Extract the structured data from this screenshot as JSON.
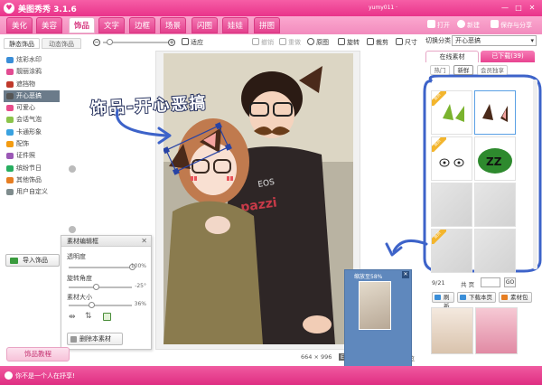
{
  "window": {
    "title": "美图秀秀 3.1.6",
    "user": "yumy011 ·",
    "controls": [
      "—",
      "□",
      "✕"
    ]
  },
  "nav": {
    "tabs": [
      "美化",
      "美容",
      "饰品",
      "文字",
      "边框",
      "场景",
      "闪图",
      "娃娃",
      "拼图"
    ],
    "active_index": 2
  },
  "top_actions": {
    "open": "打开",
    "new": "新建",
    "save_share": "保存与分享"
  },
  "left_panel": {
    "tabs": [
      "静态饰品",
      "动态饰品"
    ],
    "active_tab": 0,
    "items": [
      {
        "label": "炫彩水印",
        "color": "#3a8ed8"
      },
      {
        "label": "靓丽涂鸦",
        "color": "#e24c92"
      },
      {
        "label": "遮挡物",
        "color": "#c0392b"
      },
      {
        "label": "开心恶搞",
        "color": "#555555"
      },
      {
        "label": "可爱心",
        "color": "#e84c8a"
      },
      {
        "label": "会话气泡",
        "color": "#8bc34a"
      },
      {
        "label": "卡通形象",
        "color": "#3aa2e0"
      },
      {
        "label": "配饰",
        "color": "#f39c12"
      },
      {
        "label": "证件照",
        "color": "#9b59b6"
      },
      {
        "label": "缤纷节日",
        "color": "#27ae60"
      },
      {
        "label": "其他饰品",
        "color": "#e67e22"
      },
      {
        "label": "用户自定义",
        "color": "#7f8c8d"
      }
    ],
    "active_item": 3,
    "import_button": "导入饰品",
    "footer_button": "饰品教程"
  },
  "toolbar": {
    "fit": "适应",
    "undo": "撤销",
    "redo": "重做",
    "original": "原图",
    "rotate": "旋转",
    "crop": "裁剪",
    "size": "尺寸"
  },
  "zoom_level": 0.1,
  "material_editor": {
    "title": "素材编辑框",
    "close": "✕",
    "transparency_label": "透明度",
    "transparency_value": "100%",
    "transparency": 1.0,
    "rotation_label": "旋转角度",
    "rotation_value": "-25°",
    "rotation": 0.43,
    "size_label": "素材大小",
    "size_value": "36%",
    "size": 0.36,
    "delete_button": "删除本素材"
  },
  "status": {
    "dimensions": "664 × 996",
    "exif": "EXIF",
    "compare": "对比",
    "preview": "预览"
  },
  "zoom_preview": {
    "label": "缩放至58%",
    "close": "✕"
  },
  "right_panel": {
    "category_label": "切换分类",
    "category_value": "开心恶搞",
    "tabs": [
      "在线素材",
      "已下载(39)"
    ],
    "active_tab": 0,
    "subtabs": [
      "热门",
      "新鲜",
      "会员独享"
    ],
    "active_subtab": 1,
    "ribbon_label": "会员",
    "page": "9/21",
    "page_of": "共 页",
    "go": "GO",
    "buttons": [
      "刷新",
      "下载本页",
      "素材包"
    ]
  },
  "annotation": {
    "title": "饰品-开心恶搞"
  },
  "bottom_bar": {
    "message": "你不是一个人在抒享!"
  },
  "colors": {
    "brand_pink": "#e9338a",
    "nav_pink": "#f28bbd",
    "annotation_blue": "#3d63c9",
    "selection_blue": "#5aa0e4",
    "preview_blue": "#5f88bd"
  }
}
